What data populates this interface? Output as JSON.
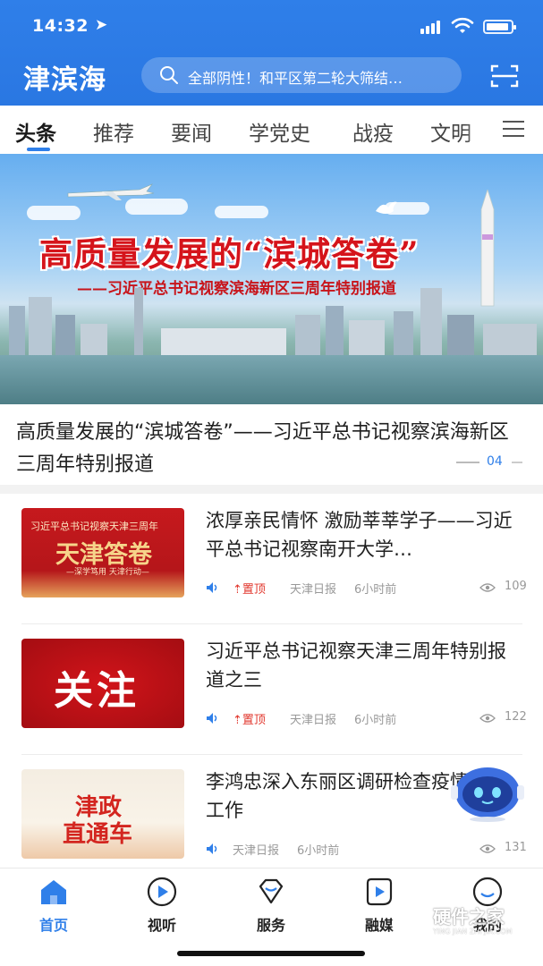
{
  "status_bar": {
    "time": "14:32",
    "location_glyph": "➤"
  },
  "header": {
    "logo": "津滨海",
    "search": {
      "placeholder": "全部阴性！和平区第二轮大筛结…"
    },
    "scan_icon": "scan-icon"
  },
  "tabs": [
    {
      "label": "头条",
      "active": true
    },
    {
      "label": "推荐"
    },
    {
      "label": "要闻"
    },
    {
      "label": "学党史"
    },
    {
      "label": "战疫"
    },
    {
      "label": "文明"
    }
  ],
  "banner": {
    "headline": "高质量发展的“滨城答卷”",
    "subline": "——习近平总书记视察滨海新区三周年特别报道",
    "caption": "高质量发展的“滨城答卷”——习近平总书记视察滨海新区三周年特别报道",
    "page_indicator": "04"
  },
  "news": [
    {
      "title": "浓厚亲民情怀 激励莘莘学子——习近平总书记视察南开大学…",
      "pinned": "置顶",
      "source": "天津日报",
      "time_ago": "6小时前",
      "views": "109",
      "thumb": {
        "line1": "习近平总书记视察天津三周年",
        "line2": "天津答卷",
        "line3": "—深学笃用 天津行动—"
      }
    },
    {
      "title": "习近平总书记视察天津三周年特别报道之三",
      "pinned": "置顶",
      "source": "天津日报",
      "time_ago": "6小时前",
      "views": "122",
      "thumb": {
        "line1": "关注"
      }
    },
    {
      "title": "李鸿忠深入东丽区调研检查疫情防控工作",
      "source": "天津日报",
      "time_ago": "6小时前",
      "views": "131",
      "thumb": {
        "line1": "津政",
        "line2": "直通车"
      }
    }
  ],
  "bottom_nav": [
    {
      "label": "首页",
      "icon": "home-icon",
      "active": true
    },
    {
      "label": "视听",
      "icon": "play-icon"
    },
    {
      "label": "服务",
      "icon": "service-icon"
    },
    {
      "label": "融媒",
      "icon": "media-icon"
    },
    {
      "label": "我的",
      "icon": "profile-icon"
    }
  ],
  "watermark": {
    "title": "硬件之家",
    "subtitle": "YING JIAN ZHI JIA.COM"
  },
  "colors": {
    "brand": "#2f7fe9",
    "pin": "#e1362c",
    "tab_indicator": "#2f7fe9"
  }
}
